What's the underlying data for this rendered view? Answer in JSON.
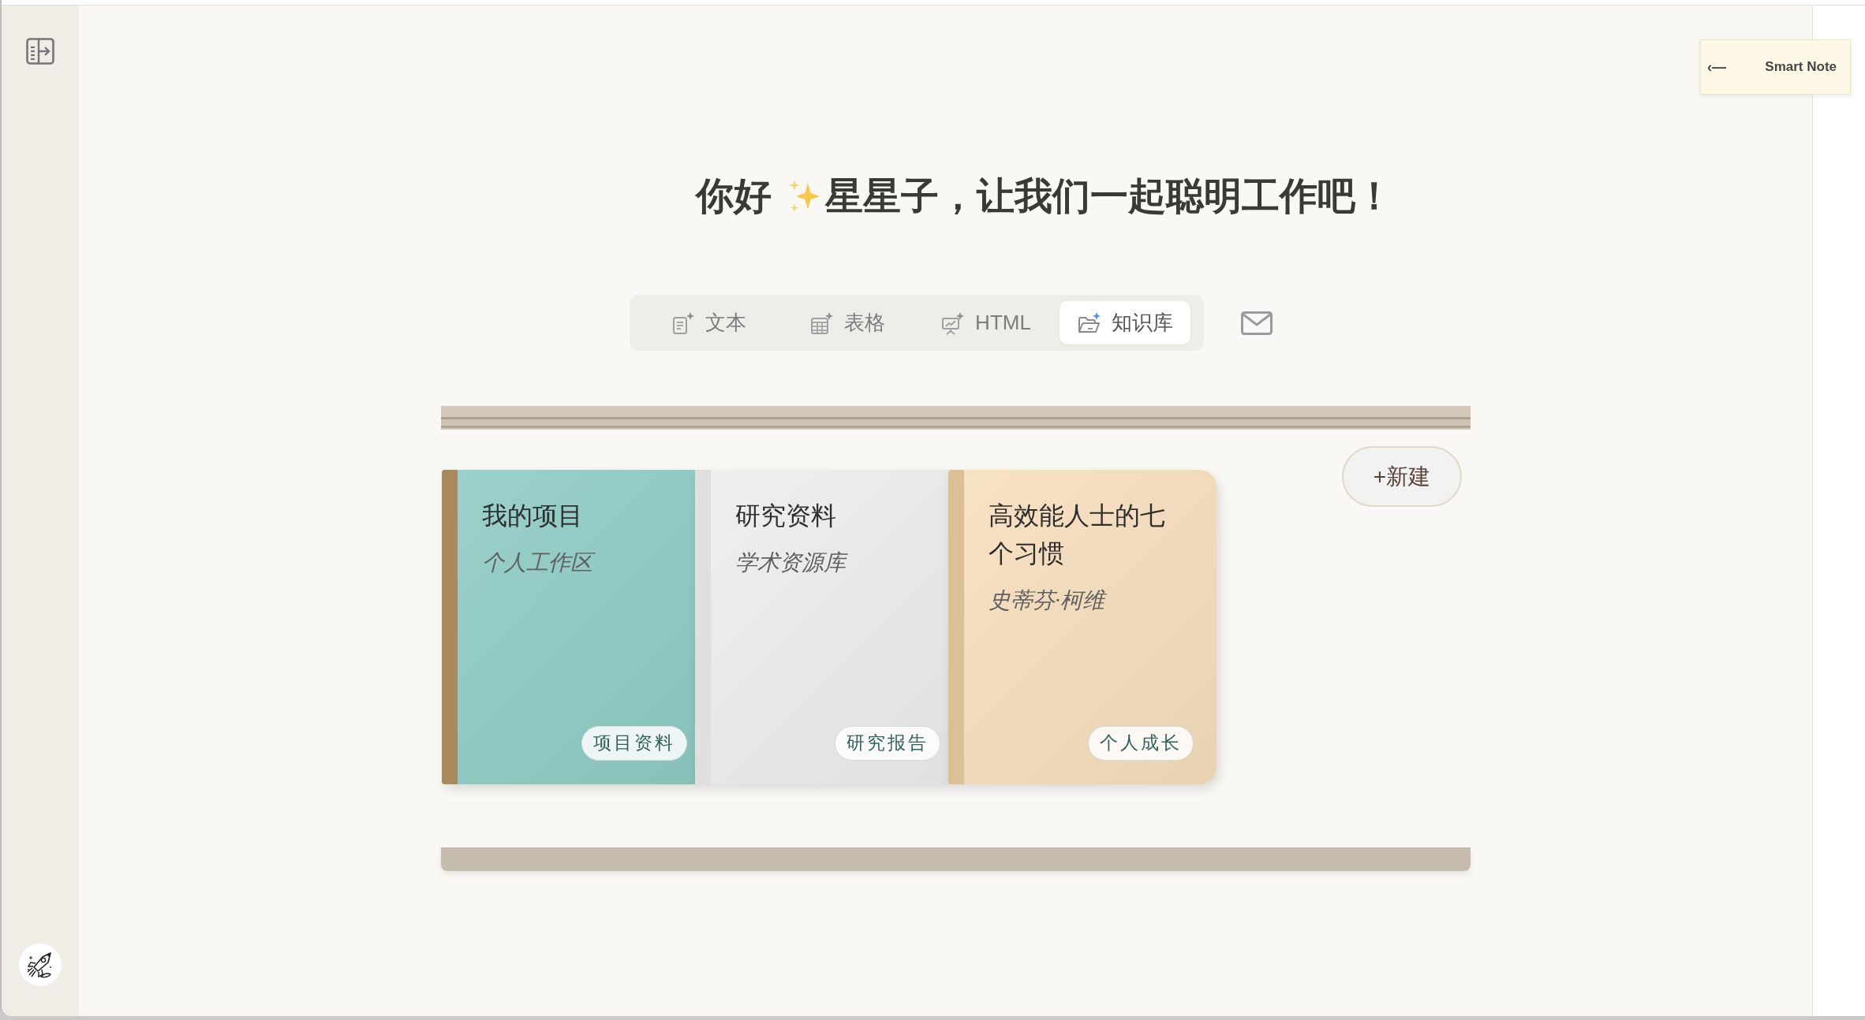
{
  "smart_note": {
    "arrow": "‹—",
    "label": "Smart Note"
  },
  "greeting": {
    "hello": "你好",
    "message": "星星子，让我们一起聪明工作吧！"
  },
  "modes": [
    {
      "label": "文本",
      "kind": "text",
      "selected": false
    },
    {
      "label": "表格",
      "kind": "table",
      "selected": false
    },
    {
      "label": "HTML",
      "kind": "html",
      "selected": false
    },
    {
      "label": "知识库",
      "kind": "knowledge",
      "selected": true
    }
  ],
  "new_button": "+新建",
  "books": [
    {
      "title": "我的项目",
      "subtitle": "个人工作区",
      "tag": "项目资料",
      "color": "#8fcdc5",
      "spine": {
        "color": "#a88a5e"
      }
    },
    {
      "title": "研究资料",
      "subtitle": "学术资源库",
      "tag": "研究报告",
      "color": "#eeeeee",
      "spine": {
        "color": "#e0dfdd"
      }
    },
    {
      "title": "高效能人士的七个习惯",
      "subtitle": "史蒂芬·柯维",
      "tag": "个人成长",
      "color": "#f7dfbd",
      "spine": {
        "color": "#dcc095"
      }
    }
  ]
}
